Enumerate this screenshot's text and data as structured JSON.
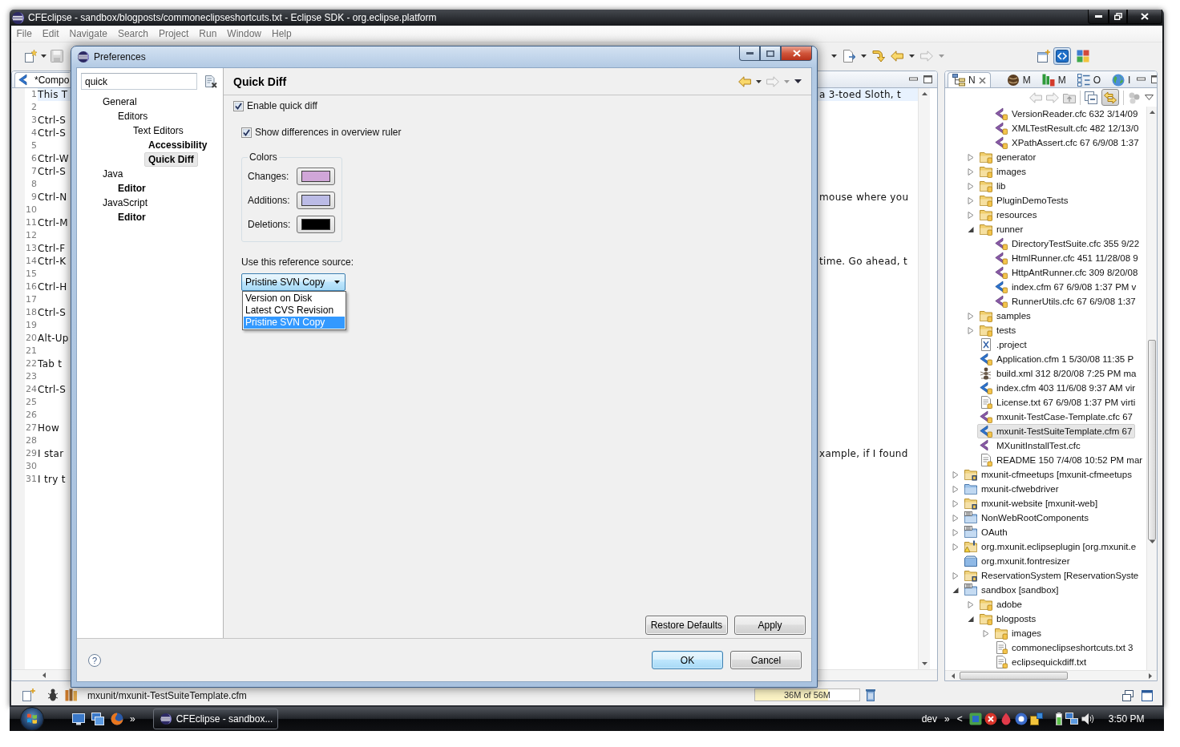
{
  "window": {
    "title": "CFEclipse - sandbox/blogposts/commoneclipseshortcuts.txt - Eclipse SDK - org.eclipse.platform"
  },
  "menu": [
    "File",
    "Edit",
    "Navigate",
    "Search",
    "Project",
    "Run",
    "Window",
    "Help"
  ],
  "perspectives": [
    {
      "kind": "chevrons",
      "selected": true
    },
    {
      "kind": "blocks",
      "selected": false
    }
  ],
  "editor": {
    "tab": {
      "label": "*Compo"
    },
    "lines": [
      {
        "number": "1",
        "left": "This T",
        "right": "a 3-toed Sloth, t",
        "current": true
      },
      {
        "number": "2",
        "current": false
      },
      {
        "number": "3",
        "left": "Ctrl-S",
        "current": false
      },
      {
        "number": "4",
        "left": "Ctrl-S",
        "current": false
      },
      {
        "number": "5",
        "current": false
      },
      {
        "number": "6",
        "left": "Ctrl-W",
        "current": false
      },
      {
        "number": "7",
        "left": "Ctrl-S",
        "current": false
      },
      {
        "number": "8",
        "current": false
      },
      {
        "number": "9",
        "left": "Ctrl-N",
        "right": "mouse where you",
        "current": false
      },
      {
        "number": "10",
        "current": false
      },
      {
        "number": "11",
        "left": "Ctrl-M",
        "current": false
      },
      {
        "number": "12",
        "current": false
      },
      {
        "number": "13",
        "left": "Ctrl-F",
        "current": false
      },
      {
        "number": "14",
        "left": "Ctrl-K",
        "right": "time. Go ahead, t",
        "current": false
      },
      {
        "number": "15",
        "current": false
      },
      {
        "number": "16",
        "left": "Ctrl-H",
        "current": false
      },
      {
        "number": "17",
        "current": false
      },
      {
        "number": "18",
        "left": "Ctrl-S",
        "current": false
      },
      {
        "number": "19",
        "current": false
      },
      {
        "number": "20",
        "left": "Alt-Up",
        "current": false
      },
      {
        "number": "21",
        "current": false
      },
      {
        "number": "22",
        "left": "Tab t",
        "current": false
      },
      {
        "number": "23",
        "current": false
      },
      {
        "number": "24",
        "left": "Ctrl-S",
        "current": false
      },
      {
        "number": "25",
        "current": false
      },
      {
        "number": "26",
        "current": false
      },
      {
        "number": "27",
        "left": "How",
        "current": false
      },
      {
        "number": "28",
        "current": false
      },
      {
        "number": "29",
        "left": "I star",
        "right": "xample, if I found",
        "current": false
      },
      {
        "number": "30",
        "current": false
      },
      {
        "number": "31",
        "left": "I try t",
        "current": false
      }
    ]
  },
  "navigator": {
    "tabs": [
      {
        "label": "N",
        "kind": "navigator",
        "selected": true
      },
      {
        "label": "M",
        "kind": "methods",
        "selected": false
      },
      {
        "label": "M",
        "kind": "mxunit",
        "selected": false
      },
      {
        "label": "O",
        "kind": "outline",
        "selected": false
      },
      {
        "label": "I",
        "kind": "globe",
        "selected": false
      }
    ],
    "link_with_editor": {
      "on": true
    },
    "tree": [
      {
        "children": [
          {
            "children": [
              {
                "label": "VersionReader.cfc 632 3/14/09",
                "kind": "cfc",
                "selected": false
              },
              {
                "label": "XMLTestResult.cfc 482 12/13/0",
                "kind": "cfc",
                "selected": false
              },
              {
                "label": "XPathAssert.cfc 67 6/9/08 1:37",
                "kind": "cfc",
                "selected": false
              }
            ]
          },
          {
            "label": "generator",
            "kind": "folder",
            "expanded": false,
            "selected": false
          },
          {
            "label": "images",
            "kind": "folder",
            "expanded": false,
            "selected": false
          },
          {
            "label": "lib",
            "kind": "folder",
            "expanded": false,
            "selected": false
          },
          {
            "label": "PluginDemoTests",
            "kind": "folder",
            "expanded": false,
            "selected": false
          },
          {
            "label": "resources",
            "kind": "folder",
            "expanded": false,
            "selected": false
          },
          {
            "label": "runner",
            "kind": "folder",
            "expanded": true,
            "selected": false,
            "children": [
              {
                "label": "DirectoryTestSuite.cfc 355 9/22",
                "kind": "cfc",
                "selected": false
              },
              {
                "label": "HtmlRunner.cfc 451 11/28/08 9",
                "kind": "cfc",
                "selected": false
              },
              {
                "label": "HttpAntRunner.cfc 309 8/20/08",
                "kind": "cfc",
                "selected": false
              },
              {
                "label": "index.cfm 67 6/9/08 1:37 PM v",
                "kind": "cfm",
                "selected": false
              },
              {
                "label": "RunnerUtils.cfc 67 6/9/08 1:37",
                "kind": "cfc",
                "selected": false
              }
            ]
          },
          {
            "label": "samples",
            "kind": "folder",
            "expanded": false,
            "selected": false
          },
          {
            "label": "tests",
            "kind": "folder",
            "expanded": false,
            "selected": false
          },
          {
            "label": ".project",
            "kind": "xml",
            "selected": false
          },
          {
            "label": "Application.cfm 1 5/30/08 11:35 P",
            "kind": "cfm",
            "selected": false
          },
          {
            "label": "build.xml 312 8/20/08 7:25 PM ma",
            "kind": "ant",
            "selected": false
          },
          {
            "label": "index.cfm 403 11/6/08 9:37 AM vir",
            "kind": "cfm",
            "selected": false
          },
          {
            "label": "License.txt 67 6/9/08 1:37 PM virti",
            "kind": "txt",
            "selected": false
          },
          {
            "label": "mxunit-TestCase-Template.cfc 67",
            "kind": "cfc",
            "selected": false
          },
          {
            "label": "mxunit-TestSuiteTemplate.cfm 67",
            "kind": "cfm",
            "selected": true
          },
          {
            "label": "MXunitInstallTest.cfc",
            "kind": "cfc-plain",
            "selected": false
          },
          {
            "label": "README 150 7/4/08 10:52 PM mar",
            "kind": "txt",
            "selected": false
          }
        ]
      },
      {
        "label": "mxunit-cfmeetups [mxunit-cfmeetups",
        "kind": "project",
        "expanded": false,
        "selected": false
      },
      {
        "label": "mxunit-cfwebdriver",
        "kind": "project-plain",
        "expanded": false,
        "selected": false
      },
      {
        "label": "mxunit-website [mxunit-web]",
        "kind": "project",
        "expanded": false,
        "selected": false
      },
      {
        "label": "NonWebRootComponents",
        "kind": "cfe-project",
        "expanded": false,
        "selected": false
      },
      {
        "label": "OAuth",
        "kind": "cfe-project",
        "expanded": false,
        "selected": false
      },
      {
        "label": "org.mxunit.eclipseplugin [org.mxunit.e",
        "kind": "plugin-project",
        "expanded": false,
        "selected": false
      },
      {
        "label": "org.mxunit.fontresizer",
        "kind": "closed-project",
        "selected": false
      },
      {
        "label": "ReservationSystem [ReservationSyste",
        "kind": "project",
        "expanded": false,
        "selected": false
      },
      {
        "label": "sandbox [sandbox]",
        "kind": "cfe-project",
        "expanded": true,
        "selected": false,
        "children": [
          {
            "label": "adobe",
            "kind": "folder",
            "expanded": false,
            "selected": false
          },
          {
            "label": "blogposts",
            "kind": "folder",
            "expanded": true,
            "selected": false,
            "children": [
              {
                "label": "images",
                "kind": "folder",
                "expanded": false,
                "selected": false
              },
              {
                "label": "commoneclipseshortcuts.txt 3",
                "kind": "txt",
                "selected": false
              },
              {
                "label": "eclipsequickdiff.txt",
                "kind": "txt",
                "selected": false
              }
            ]
          }
        ]
      }
    ]
  },
  "status_bar": {
    "path": "mxunit/mxunit-TestSuiteTemplate.cfm",
    "heap": {
      "reading": "36M of 56M",
      "level": 0.7
    }
  },
  "preferences": {
    "title": "Preferences",
    "filter": {
      "value": "quick"
    },
    "tree": [
      {
        "label": "General",
        "matched": false,
        "selected": false,
        "children": [
          {
            "label": "Editors",
            "matched": false,
            "selected": false,
            "children": [
              {
                "label": "Text Editors",
                "matched": false,
                "selected": false,
                "children": [
                  {
                    "label": "Accessibility",
                    "matched": true,
                    "selected": false
                  },
                  {
                    "label": "Quick Diff",
                    "matched": true,
                    "selected": true
                  }
                ]
              }
            ]
          }
        ]
      },
      {
        "label": "Java",
        "matched": false,
        "selected": false,
        "children": [
          {
            "label": "Editor",
            "matched": true,
            "selected": false
          }
        ]
      },
      {
        "label": "JavaScript",
        "matched": false,
        "selected": false,
        "children": [
          {
            "label": "Editor",
            "matched": true,
            "selected": false
          }
        ]
      }
    ],
    "page": {
      "title": "Quick Diff",
      "enable": {
        "label": "Enable quick diff",
        "checked": true
      },
      "overview_ruler": {
        "label": "Show differences in overview ruler",
        "checked": true
      },
      "colors": {
        "title": "Colors",
        "items": [
          {
            "label": "Changes:",
            "color": "#d0a6d8"
          },
          {
            "label": "Additions:",
            "color": "#bbbbe6"
          },
          {
            "label": "Deletions:",
            "color": "#000000"
          }
        ]
      },
      "reference_source": {
        "label": "Use this reference source:",
        "value": "Pristine SVN Copy",
        "expanded": true,
        "options": [
          {
            "label": "Version on Disk",
            "selected": false
          },
          {
            "label": "Latest CVS Revision",
            "selected": false
          },
          {
            "label": "Pristine SVN Copy",
            "selected": true
          }
        ]
      },
      "buttons": [
        "Restore Defaults",
        "Apply"
      ]
    },
    "help": "?",
    "buttons": [
      {
        "label": "OK",
        "default": true
      },
      {
        "label": "Cancel",
        "default": false
      }
    ]
  },
  "taskbar": {
    "quick_launch_more": "»",
    "task": {
      "label": "CFEclipse - sandbox..."
    },
    "tray": {
      "toolbar": "dev",
      "more": "»",
      "expand": "<",
      "clock": "3:50 PM"
    }
  }
}
